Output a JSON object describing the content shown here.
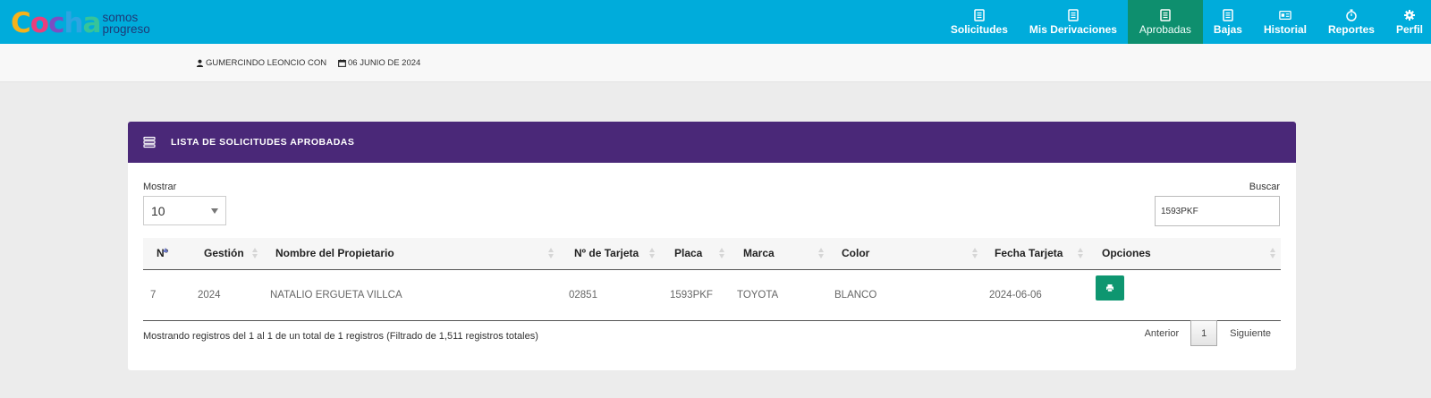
{
  "brand": {
    "logo_letters": [
      "C",
      "o",
      "c",
      "h",
      "a"
    ],
    "tagline_line1": "somos",
    "tagline_line2": "progreso"
  },
  "nav": {
    "items": [
      {
        "label": "Solicitudes",
        "icon": "document-icon"
      },
      {
        "label": "Mis Derivaciones",
        "icon": "document-icon"
      },
      {
        "label": "Aprobadas",
        "icon": "document-icon",
        "active": true
      },
      {
        "label": "Bajas",
        "icon": "document-icon"
      },
      {
        "label": "Historial",
        "icon": "id-card-icon"
      },
      {
        "label": "Reportes",
        "icon": "stopwatch-icon"
      },
      {
        "label": "Perfil",
        "icon": "gear-icon"
      }
    ]
  },
  "subbar": {
    "user": "GUMERCINDO LEONCIO CON",
    "date": "06 JUNIO DE 2024"
  },
  "card": {
    "title": "LISTA DE SOLICITUDES APROBADAS",
    "show_label": "Mostrar",
    "show_value": "10",
    "search_label": "Buscar",
    "search_value": "1593PKF"
  },
  "table": {
    "columns": [
      "Nº",
      "Gestión",
      "Nombre del Propietario",
      "Nº de Tarjeta",
      "Placa",
      "Marca",
      "Color",
      "Fecha Tarjeta",
      "Opciones"
    ],
    "rows": [
      {
        "n": "7",
        "gestion": "2024",
        "propietario": "NATALIO ERGUETA VILLCA",
        "tarjeta": "02851",
        "placa": "1593PKF",
        "marca": "TOYOTA",
        "color": "BLANCO",
        "fecha": "2024-06-06"
      }
    ]
  },
  "footer": {
    "info": "Mostrando registros del 1 al 1 de un total de 1 registros (Filtrado de 1,511 registros totales)",
    "prev": "Anterior",
    "page": "1",
    "next": "Siguiente"
  },
  "colors": {
    "topbar": "#00acdb",
    "active_nav": "#0e8f6e",
    "card_header": "#4a2878",
    "print_button": "#0e9670"
  }
}
